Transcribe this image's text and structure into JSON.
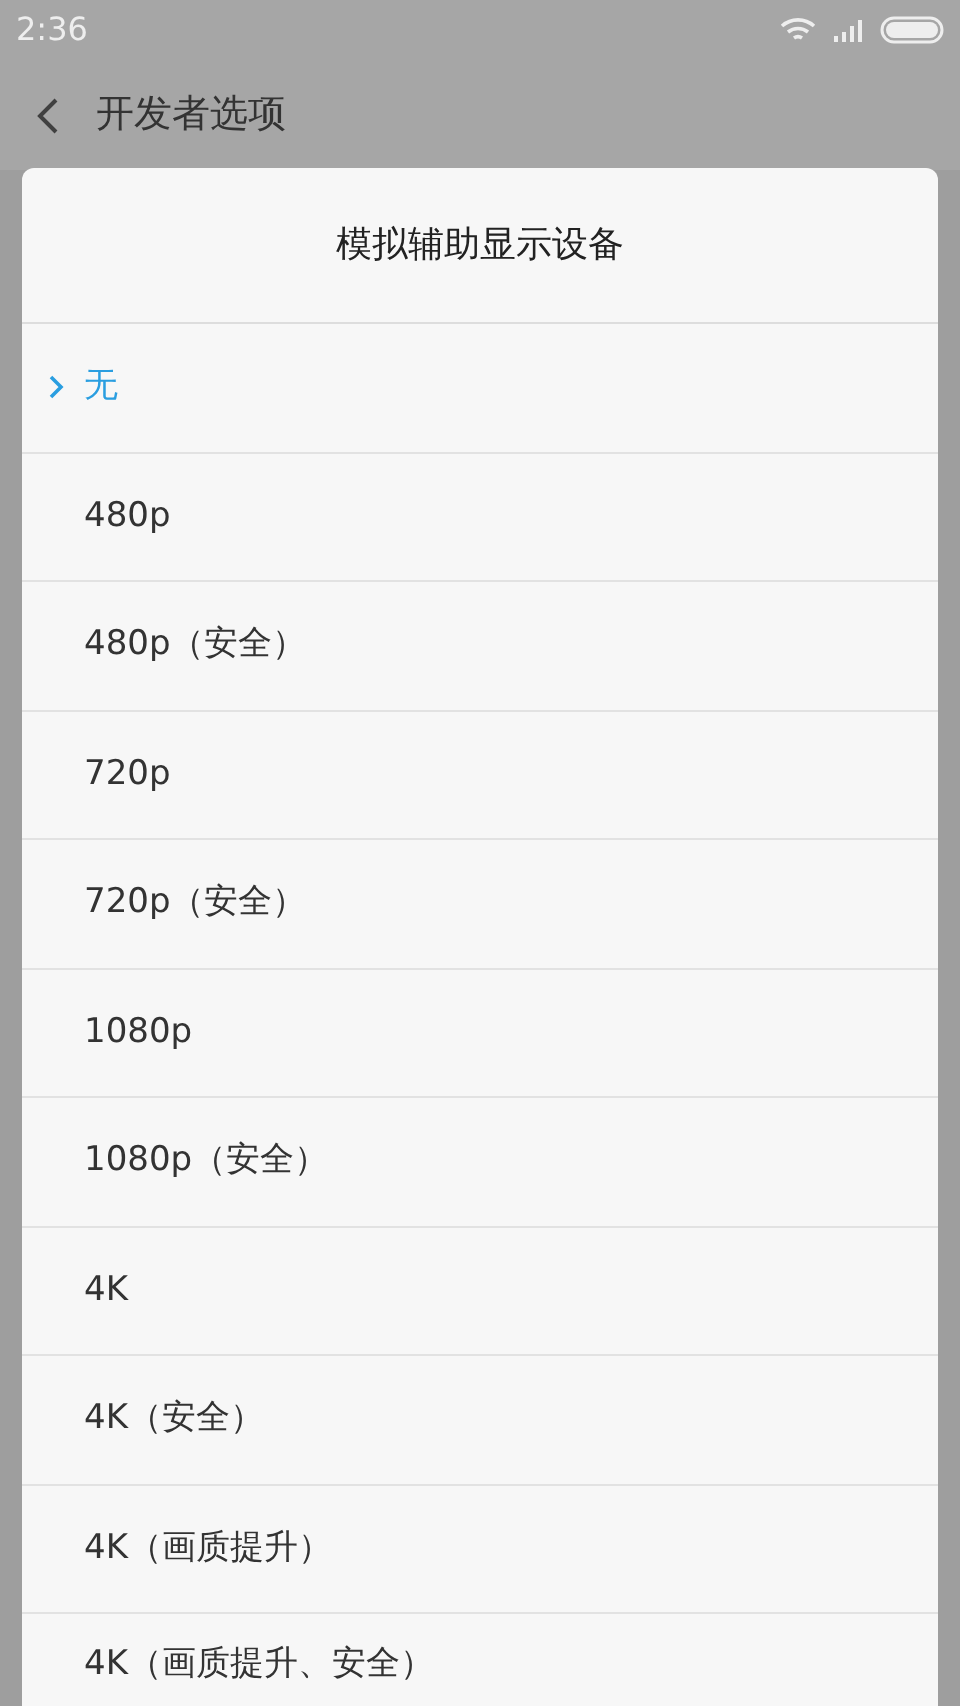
{
  "status_bar": {
    "time": "2:36"
  },
  "header": {
    "title": "开发者选项"
  },
  "dialog": {
    "title": "模拟辅助显示设备",
    "options": [
      {
        "label": "无",
        "selected": true
      },
      {
        "label": "480p",
        "selected": false
      },
      {
        "label": "480p（安全）",
        "selected": false
      },
      {
        "label": "720p",
        "selected": false
      },
      {
        "label": "720p（安全）",
        "selected": false
      },
      {
        "label": "1080p",
        "selected": false
      },
      {
        "label": "1080p（安全）",
        "selected": false
      },
      {
        "label": "4K",
        "selected": false
      },
      {
        "label": "4K（安全）",
        "selected": false
      },
      {
        "label": "4K（画质提升）",
        "selected": false
      },
      {
        "label": "4K（画质提升、安全）",
        "selected": false
      }
    ]
  }
}
